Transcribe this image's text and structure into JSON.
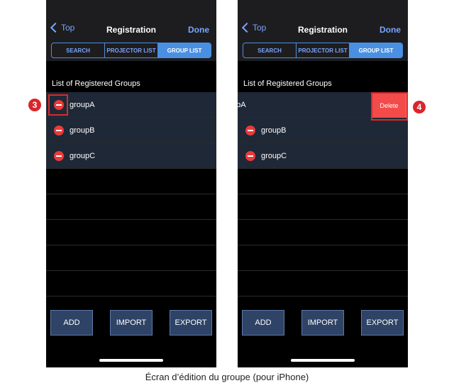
{
  "screens": [
    {
      "nav": {
        "back_label": "Top",
        "title": "Registration",
        "done_label": "Done"
      },
      "tabs": [
        {
          "label": "SEARCH",
          "active": false
        },
        {
          "label": "PROJECTOR LIST",
          "active": false
        },
        {
          "label": "GROUP LIST",
          "active": true
        }
      ],
      "section_header": "List of Registered Groups",
      "groups": [
        {
          "label": "groupA"
        },
        {
          "label": "groupB"
        },
        {
          "label": "groupC"
        }
      ],
      "buttons": {
        "add": "ADD",
        "import": "IMPORT",
        "export": "EXPORT"
      }
    },
    {
      "nav": {
        "back_label": "Top",
        "title": "Registration",
        "done_label": "Done"
      },
      "tabs": [
        {
          "label": "SEARCH",
          "active": false
        },
        {
          "label": "PROJECTOR LIST",
          "active": false
        },
        {
          "label": "GROUP LIST",
          "active": true
        }
      ],
      "section_header": "List of Registered Groups",
      "groups": [
        {
          "label": "upA",
          "delete_label": "Delete"
        },
        {
          "label": "groupB"
        },
        {
          "label": "groupC"
        }
      ],
      "buttons": {
        "add": "ADD",
        "import": "IMPORT",
        "export": "EXPORT"
      }
    }
  ],
  "markers": {
    "left": "3",
    "right": "4"
  },
  "caption": "Écran d’édition du groupe (pour iPhone)",
  "colors": {
    "accent": "#4a90e2",
    "delete": "#f34a4a",
    "marker": "#d8262c"
  }
}
